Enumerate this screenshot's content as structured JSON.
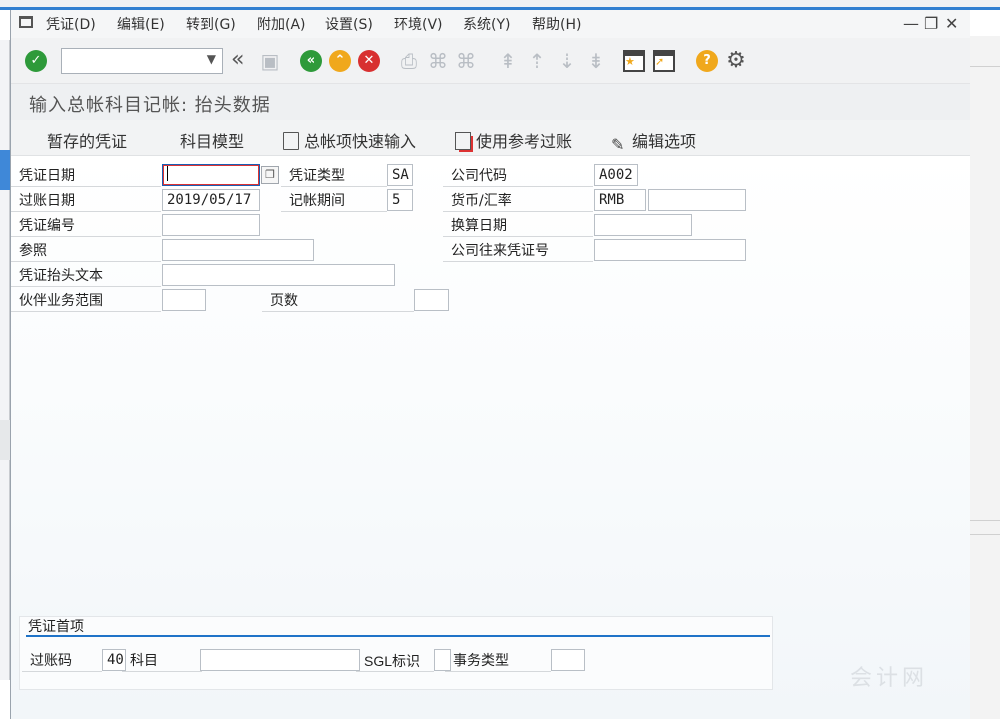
{
  "menubar": {
    "items": [
      "凭证(D)",
      "编辑(E)",
      "转到(G)",
      "附加(A)",
      "设置(S)",
      "环境(V)",
      "系统(Y)",
      "帮助(H)"
    ],
    "window_controls": [
      "—",
      "❐",
      "✕"
    ]
  },
  "toolbar": {
    "command_field": {
      "value": "",
      "placeholder": ""
    },
    "icons": [
      "enter-check-icon",
      "command-field-dropdown",
      "collapse-left-icon",
      "save-icon",
      "back-icon",
      "exit-icon",
      "cancel-icon",
      "print-icon",
      "find-icon",
      "find-next-icon",
      "first-page-icon",
      "prev-page-icon",
      "next-page-icon",
      "last-page-icon",
      "new-session-icon",
      "shortcut-icon",
      "help-icon",
      "settings-gear-icon"
    ],
    "colors": {
      "green": "#2e9a3a",
      "orange": "#f0a81c",
      "red": "#d83030"
    }
  },
  "title": "输入总帐科目记帐: 抬头数据",
  "app_toolbar": {
    "park": "暂存的凭证",
    "acct_model": "科目模型",
    "fast_entry": "总帐项快速输入",
    "post_with_ref": "使用参考过账",
    "edit_options": "编辑选项"
  },
  "header": {
    "doc_date": {
      "label": "凭证日期",
      "value": ""
    },
    "doc_type": {
      "label": "凭证类型",
      "value": "SA"
    },
    "company_code": {
      "label": "公司代码",
      "value": "A002"
    },
    "posting_date": {
      "label": "过账日期",
      "value": "2019/05/17"
    },
    "period": {
      "label": "记帐期间",
      "value": "5"
    },
    "currency": {
      "label": "货币/汇率",
      "value": "RMB",
      "rate": ""
    },
    "doc_number": {
      "label": "凭证编号",
      "value": ""
    },
    "translation_date": {
      "label": "换算日期",
      "value": ""
    },
    "reference": {
      "label": "参照",
      "value": ""
    },
    "intercompany_no": {
      "label": "公司往来凭证号",
      "value": ""
    },
    "header_text": {
      "label": "凭证抬头文本",
      "value": ""
    },
    "partner_ba": {
      "label": "伙伴业务范围",
      "value": ""
    },
    "pages": {
      "label": "页数",
      "value": ""
    }
  },
  "first_item": {
    "title": "凭证首项",
    "posting_key": {
      "label": "过账码",
      "value": "40"
    },
    "account": {
      "label": "科目",
      "value": ""
    },
    "sgl_ind": {
      "label": "SGL标识",
      "value": ""
    },
    "trans_type": {
      "label": "事务类型",
      "value": ""
    }
  },
  "watermark": "会计网"
}
